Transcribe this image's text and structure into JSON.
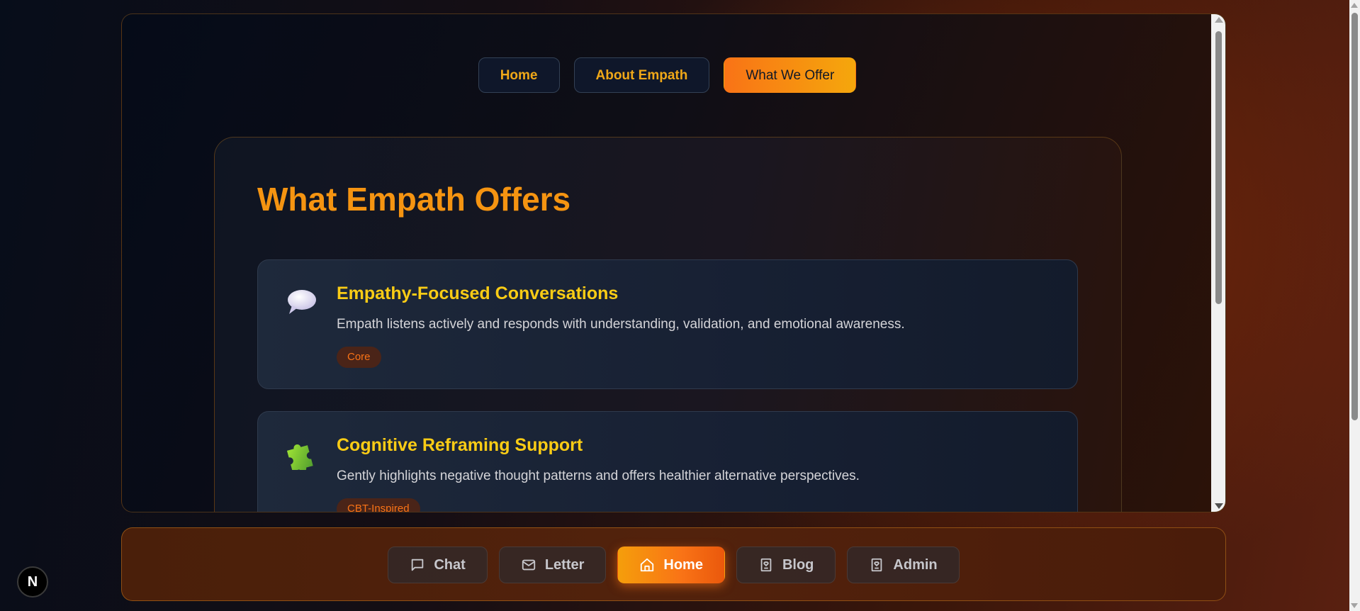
{
  "top_nav": {
    "tabs": [
      {
        "label": "Home",
        "active": false
      },
      {
        "label": "About Empath",
        "active": false
      },
      {
        "label": "What We Offer",
        "active": true
      }
    ]
  },
  "section": {
    "title": "What Empath Offers",
    "features": [
      {
        "icon": "speech-bubble-icon",
        "title": "Empathy-Focused Conversations",
        "description": "Empath listens actively and responds with understanding, validation, and emotional awareness.",
        "badge": "Core"
      },
      {
        "icon": "puzzle-piece-icon",
        "title": "Cognitive Reframing Support",
        "description": "Gently highlights negative thought patterns and offers healthier alternative perspectives.",
        "badge": "CBT-Inspired"
      }
    ]
  },
  "bottom_nav": {
    "items": [
      {
        "label": "Chat",
        "icon": "chat-icon",
        "active": false
      },
      {
        "label": "Letter",
        "icon": "mail-icon",
        "active": false
      },
      {
        "label": "Home",
        "icon": "home-icon",
        "active": true
      },
      {
        "label": "Blog",
        "icon": "book-heart-icon",
        "active": false
      },
      {
        "label": "Admin",
        "icon": "book-heart-icon",
        "active": false
      }
    ]
  },
  "dev_badge": {
    "label": "N"
  },
  "colors": {
    "accent_orange": "#f97316",
    "accent_amber": "#f5a70c",
    "title_orange": "#f59411",
    "feature_title_yellow": "#facc15"
  }
}
